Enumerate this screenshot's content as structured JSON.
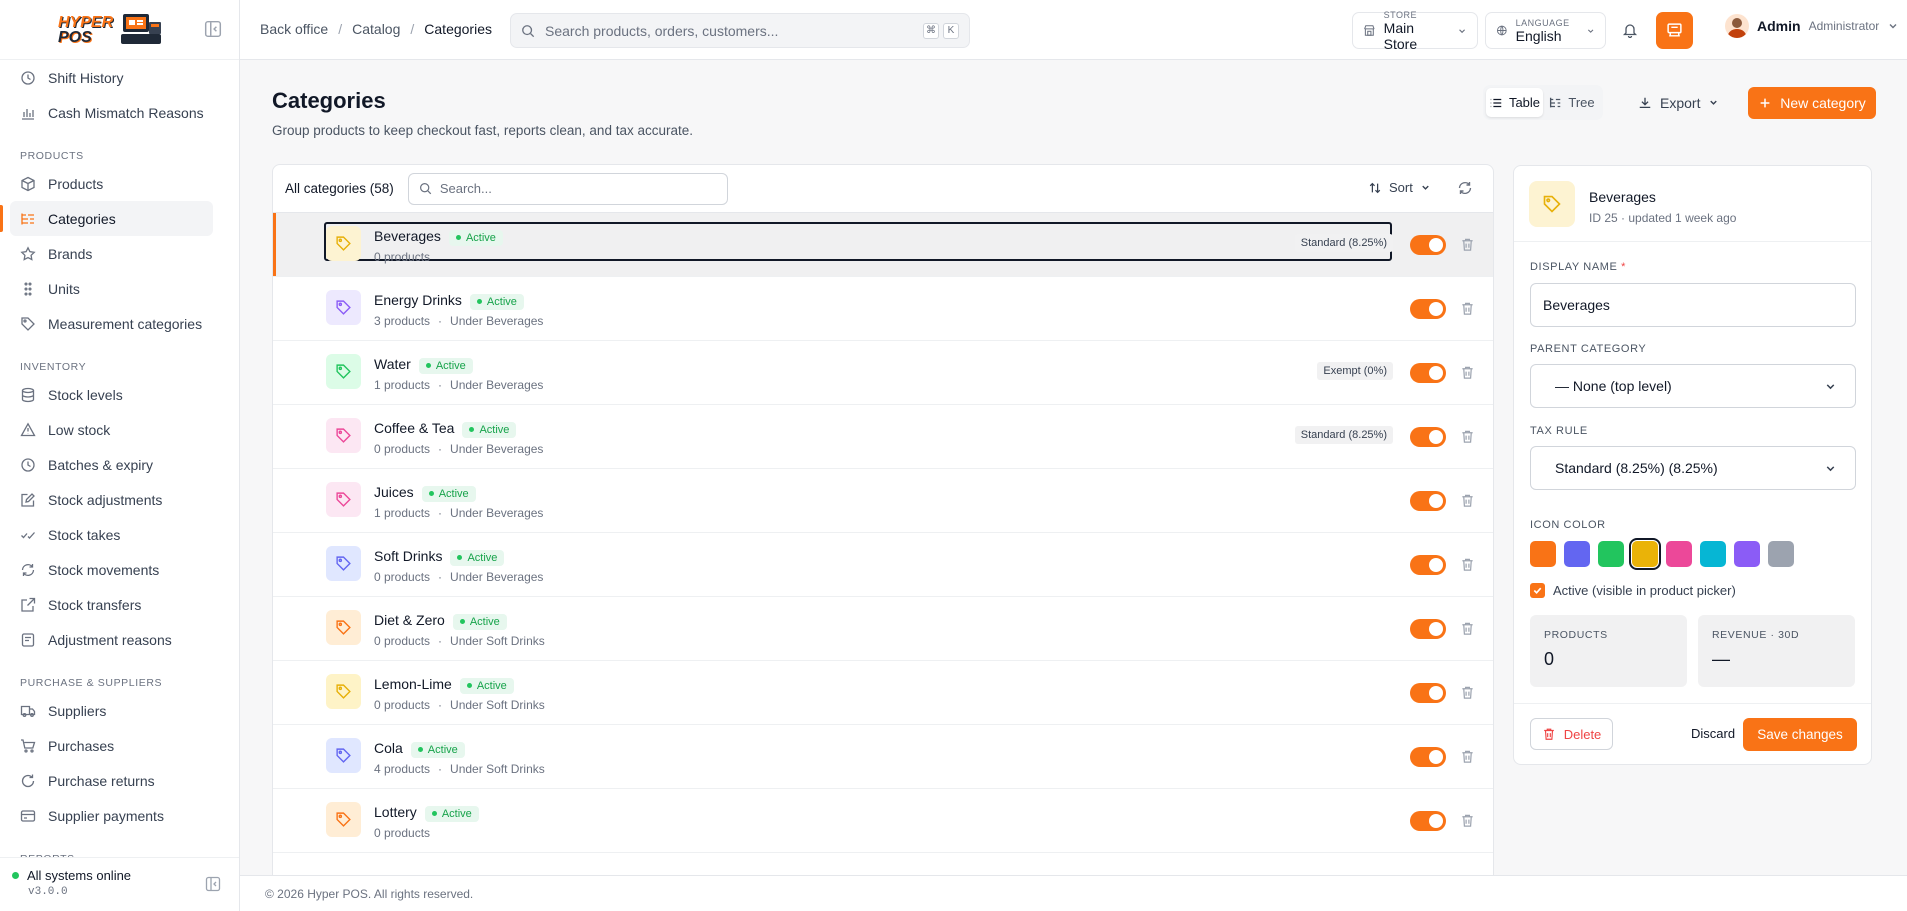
{
  "brand": {
    "line1": "HYPER",
    "line2": "POS"
  },
  "sidebar": {
    "top_items": [
      {
        "label": "Shift History",
        "icon": "clock-icon"
      },
      {
        "label": "Cash Mismatch Reasons",
        "icon": "bar-chart-icon"
      }
    ],
    "sections": [
      {
        "title": "PRODUCTS",
        "items": [
          {
            "label": "Products",
            "icon": "box-icon"
          },
          {
            "label": "Categories",
            "icon": "list-tree-icon",
            "active": true
          },
          {
            "label": "Brands",
            "icon": "star-icon"
          },
          {
            "label": "Units",
            "icon": "grip-icon"
          },
          {
            "label": "Measurement categories",
            "icon": "tag-icon"
          }
        ]
      },
      {
        "title": "INVENTORY",
        "items": [
          {
            "label": "Stock levels",
            "icon": "database-icon"
          },
          {
            "label": "Low stock",
            "icon": "warning-icon"
          },
          {
            "label": "Batches & expiry",
            "icon": "clock-icon"
          },
          {
            "label": "Stock adjustments",
            "icon": "edit-icon"
          },
          {
            "label": "Stock takes",
            "icon": "check-list-icon"
          },
          {
            "label": "Stock movements",
            "icon": "refresh-icon"
          },
          {
            "label": "Stock transfers",
            "icon": "external-icon"
          },
          {
            "label": "Adjustment reasons",
            "icon": "note-icon"
          }
        ]
      },
      {
        "title": "PURCHASE & SUPPLIERS",
        "items": [
          {
            "label": "Suppliers",
            "icon": "truck-icon"
          },
          {
            "label": "Purchases",
            "icon": "cart-icon"
          },
          {
            "label": "Purchase returns",
            "icon": "undo-icon"
          },
          {
            "label": "Supplier payments",
            "icon": "card-icon"
          }
        ]
      },
      {
        "title": "REPORTS",
        "items": []
      }
    ],
    "status": "All systems online",
    "version": "v3.0.0"
  },
  "topbar": {
    "breadcrumbs": [
      "Back office",
      "Catalog",
      "Categories"
    ],
    "search_placeholder": "Search products, orders, customers...",
    "kbd": [
      "⌘",
      "K"
    ],
    "store_label": "STORE",
    "store_value": "Main Store",
    "language_label": "LANGUAGE",
    "language_value": "English",
    "user_name": "Admin",
    "user_role": "Administrator"
  },
  "page": {
    "title": "Categories",
    "subtitle": "Group products to keep checkout fast, reports clean, and tax accurate.",
    "view_table": "Table",
    "view_tree": "Tree",
    "export": "Export",
    "new_category": "New category"
  },
  "list": {
    "title": "All categories (58)",
    "search_placeholder": "Search...",
    "sort": "Sort",
    "rows": [
      {
        "name": "Beverages",
        "status": "Active",
        "products": "0 products",
        "parent": "",
        "tax": "Standard (8.25%)",
        "color": "#e7b008",
        "bg": "#fdf3d2",
        "selected": true
      },
      {
        "name": "Energy Drinks",
        "status": "Active",
        "products": "3 products",
        "parent": "Under Beverages",
        "tax": "",
        "color": "#8b5cf6",
        "bg": "#ede9fe"
      },
      {
        "name": "Water",
        "status": "Active",
        "products": "1 products",
        "parent": "Under Beverages",
        "tax": "Exempt (0%)",
        "color": "#22c55e",
        "bg": "#dcfce7"
      },
      {
        "name": "Coffee & Tea",
        "status": "Active",
        "products": "0 products",
        "parent": "Under Beverages",
        "tax": "Standard (8.25%)",
        "color": "#ec4899",
        "bg": "#fce7f3"
      },
      {
        "name": "Juices",
        "status": "Active",
        "products": "1 products",
        "parent": "Under Beverages",
        "tax": "",
        "color": "#ec4899",
        "bg": "#fce7f3"
      },
      {
        "name": "Soft Drinks",
        "status": "Active",
        "products": "0 products",
        "parent": "Under Beverages",
        "tax": "",
        "color": "#6366f1",
        "bg": "#e0e7ff"
      },
      {
        "name": "Diet & Zero",
        "status": "Active",
        "products": "0 products",
        "parent": "Under Soft Drinks",
        "tax": "",
        "color": "#f97316",
        "bg": "#ffedd5"
      },
      {
        "name": "Lemon-Lime",
        "status": "Active",
        "products": "0 products",
        "parent": "Under Soft Drinks",
        "tax": "",
        "color": "#e7b008",
        "bg": "#fef3c7"
      },
      {
        "name": "Cola",
        "status": "Active",
        "products": "4 products",
        "parent": "Under Soft Drinks",
        "tax": "",
        "color": "#6366f1",
        "bg": "#e0e7ff"
      },
      {
        "name": "Lottery",
        "status": "Active",
        "products": "0 products",
        "parent": "",
        "tax": "",
        "color": "#f97316",
        "bg": "#ffedd5"
      }
    ]
  },
  "detail": {
    "title": "Beverages",
    "subtitle": "ID 25 · updated 1 week ago",
    "display_name_label": "DISPLAY NAME",
    "required_mark": "*",
    "display_name_value": "Beverages",
    "parent_label": "PARENT CATEGORY",
    "parent_value": "— None (top level)",
    "tax_label": "TAX RULE",
    "tax_value": "Standard (8.25%) (8.25%)",
    "color_label": "ICON COLOR",
    "colors": [
      "#f97316",
      "#6366f1",
      "#22c55e",
      "#eab308",
      "#ec4899",
      "#06b6d4",
      "#8b5cf6",
      "#9ca3af"
    ],
    "selected_color_index": 3,
    "active_label": "Active (visible in product picker)",
    "products_label": "PRODUCTS",
    "products_value": "0",
    "revenue_label": "REVENUE · 30D",
    "revenue_value": "—",
    "delete": "Delete",
    "discard": "Discard",
    "save": "Save changes"
  },
  "footer": "© 2026 Hyper POS. All rights reserved."
}
